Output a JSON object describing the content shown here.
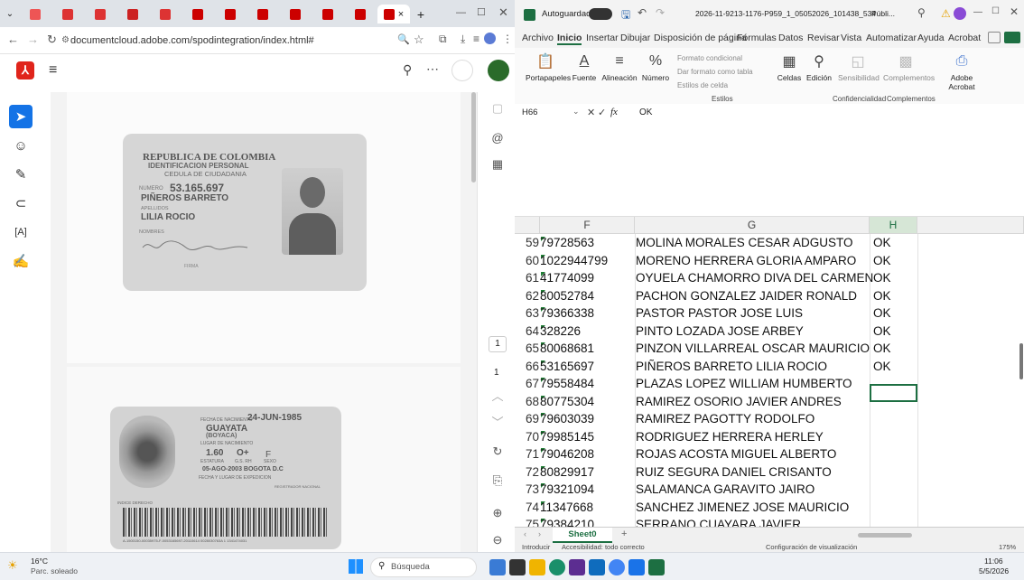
{
  "browser": {
    "url": "documentcloud.adobe.com/spodintegration/index.html#",
    "tab_close": "×",
    "new_tab": "+"
  },
  "id_card": {
    "front": {
      "country": "REPUBLICA DE COLOMBIA",
      "doc_type": "IDENTIFICACION PERSONAL",
      "doc_subtype": "CEDULA DE CIUDADANIA",
      "numero_label": "NUMERO",
      "numero": "53.165.697",
      "surnames": "PIÑEROS BARRETO",
      "apellidos_label": "APELLIDOS",
      "given_names": "LILIA ROCIO",
      "nombres_label": "NOMBRES",
      "firma_label": "FIRMA"
    },
    "back": {
      "birth_label": "FECHA DE NACIMIENTO",
      "birth_date": "24-JUN-1985",
      "birth_place": "GUAYATA",
      "birth_region": "(BOYACA)",
      "birth_place_label": "LUGAR DE NACIMIENTO",
      "height": "1.60",
      "blood": "O+",
      "sex": "F",
      "height_label": "ESTATURA",
      "blood_label": "G.S. RH",
      "sex_label": "SEXO",
      "issue": "05-AGO-2003 BOGOTA D.C",
      "issue_label": "FECHA Y LUGAR DE EXPEDICION",
      "index_label": "INDICE DERECHO",
      "registrar": "REGISTRADOR NACIONAL",
      "barcode_text": "A-1500150-00035975-F-0053165697-20110614     0028030763A 1     1341474031"
    }
  },
  "pdf_nav": {
    "page1": "1",
    "page2": "1"
  },
  "excel": {
    "autosave_label": "Autoguardado",
    "filename": "2026-11-9213-1176-P959_1_05052026_101438_534",
    "published": "Públi...",
    "menu": [
      "Archivo",
      "Inicio",
      "Insertar",
      "Dibujar",
      "Disposición de página",
      "Fórmulas",
      "Datos",
      "Revisar",
      "Vista",
      "Automatizar",
      "Ayuda",
      "Acrobat"
    ],
    "ribbon": {
      "portapapeles": "Portapapeles",
      "fuente": "Fuente",
      "alineacion": "Alineación",
      "numero": "Número",
      "formato_condicional": "Formato condicional",
      "dar_formato": "Dar formato como tabla",
      "estilos_celda": "Estilos de celda",
      "estilos": "Estilos",
      "celdas": "Celdas",
      "edicion": "Edición",
      "sensibilidad": "Sensibilidad",
      "complementos": "Complementos",
      "adobe_acrobat": "Adobe Acrobat",
      "group_confidencialidad": "Confidencialidad",
      "group_complementos": "Complementos"
    },
    "namebox": "H66",
    "formula_value": "OK",
    "columns": [
      "F",
      "G",
      "H"
    ],
    "rows": [
      {
        "n": "59",
        "f": "79728563",
        "g": "MOLINA MORALES CESAR ADGUSTO",
        "h": "OK"
      },
      {
        "n": "60",
        "f": "1022944799",
        "g": "MORENO HERRERA GLORIA AMPARO",
        "h": "OK"
      },
      {
        "n": "61",
        "f": "41774099",
        "g": "OYUELA CHAMORRO DIVA DEL CARMEN",
        "h": "OK"
      },
      {
        "n": "62",
        "f": "80052784",
        "g": "PACHON GONZALEZ JAIDER RONALD",
        "h": "OK"
      },
      {
        "n": "63",
        "f": "79366338",
        "g": "PASTOR PASTOR JOSE LUIS",
        "h": "OK"
      },
      {
        "n": "64",
        "f": "328226",
        "g": "PINTO LOZADA JOSE ARBEY",
        "h": "OK"
      },
      {
        "n": "65",
        "f": "80068681",
        "g": "PINZON VILLARREAL OSCAR MAURICIO",
        "h": "OK"
      },
      {
        "n": "66",
        "f": "53165697",
        "g": "PIÑEROS BARRETO LILIA ROCIO",
        "h": "OK"
      },
      {
        "n": "67",
        "f": "79558484",
        "g": "PLAZAS LOPEZ WILLIAM HUMBERTO",
        "h": ""
      },
      {
        "n": "68",
        "f": "80775304",
        "g": "RAMIREZ OSORIO JAVIER ANDRES",
        "h": ""
      },
      {
        "n": "69",
        "f": "79603039",
        "g": "RAMIREZ PAGOTTY RODOLFO",
        "h": ""
      },
      {
        "n": "70",
        "f": "79985145",
        "g": "RODRIGUEZ HERRERA HERLEY",
        "h": ""
      },
      {
        "n": "71",
        "f": "79046208",
        "g": "ROJAS ACOSTA MIGUEL ALBERTO",
        "h": ""
      },
      {
        "n": "72",
        "f": "80829917",
        "g": "RUIZ SEGURA DANIEL CRISANTO",
        "h": ""
      },
      {
        "n": "73",
        "f": "79321094",
        "g": "SALAMANCA GARAVITO JAIRO",
        "h": ""
      },
      {
        "n": "74",
        "f": "11347668",
        "g": "SANCHEZ JIMENEZ JOSE MAURICIO",
        "h": ""
      },
      {
        "n": "75",
        "f": "79384210",
        "g": "SERRANO CUAYARA JAVIER",
        "h": ""
      }
    ],
    "sheet_tab": "Sheet0",
    "add_sheet": "+",
    "status_mode": "Introducir",
    "status_accessibility": "Accesibilidad: todo correcto",
    "status_display": "Configuración de visualización",
    "zoom": "175%"
  },
  "taskbar": {
    "temp": "16°C",
    "weather": "Parc. soleado",
    "search": "Búsqueda",
    "time": "11:06",
    "date": "5/5/2026"
  }
}
